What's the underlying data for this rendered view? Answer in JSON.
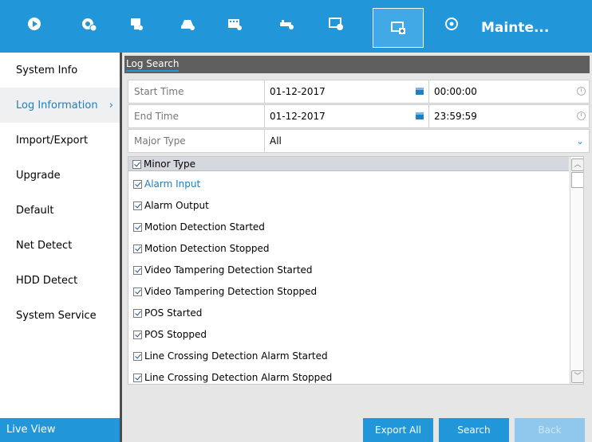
{
  "topbar": {
    "icons": [
      "playback-icon",
      "camera-settings-icon",
      "record-icon",
      "alarm-icon",
      "video-settings-icon",
      "network-icon",
      "system-config-icon",
      "maintenance-icon",
      "power-icon"
    ],
    "label": "Mainte...",
    "active_index": 7
  },
  "sidebar": {
    "items": [
      {
        "label": "System Info"
      },
      {
        "label": "Log Information",
        "active": true
      },
      {
        "label": "Import/Export"
      },
      {
        "label": "Upgrade"
      },
      {
        "label": "Default"
      },
      {
        "label": "Net Detect"
      },
      {
        "label": "HDD Detect"
      },
      {
        "label": "System Service"
      }
    ],
    "live_view": "Live View"
  },
  "panel": {
    "title": "Log Search"
  },
  "form": {
    "start_time_label": "Start Time",
    "start_date": "01-12-2017",
    "start_time": "00:00:00",
    "end_time_label": "End Time",
    "end_date": "01-12-2017",
    "end_time": "23:59:59",
    "major_type_label": "Major Type",
    "major_type_value": "All"
  },
  "minor_types": {
    "header": "Minor Type",
    "items": [
      "Alarm Input",
      "Alarm Output",
      "Motion Detection Started",
      "Motion Detection Stopped",
      "Video Tampering Detection Started",
      "Video Tampering Detection Stopped",
      "POS Started",
      "POS Stopped",
      "Line Crossing Detection Alarm Started",
      "Line Crossing Detection Alarm Stopped"
    ]
  },
  "buttons": {
    "export_all": "Export All",
    "search": "Search",
    "back": "Back"
  },
  "colors": {
    "accent": "#2196d9",
    "header_bar": "#5f5f5f",
    "active_text": "#1f7ec4"
  }
}
